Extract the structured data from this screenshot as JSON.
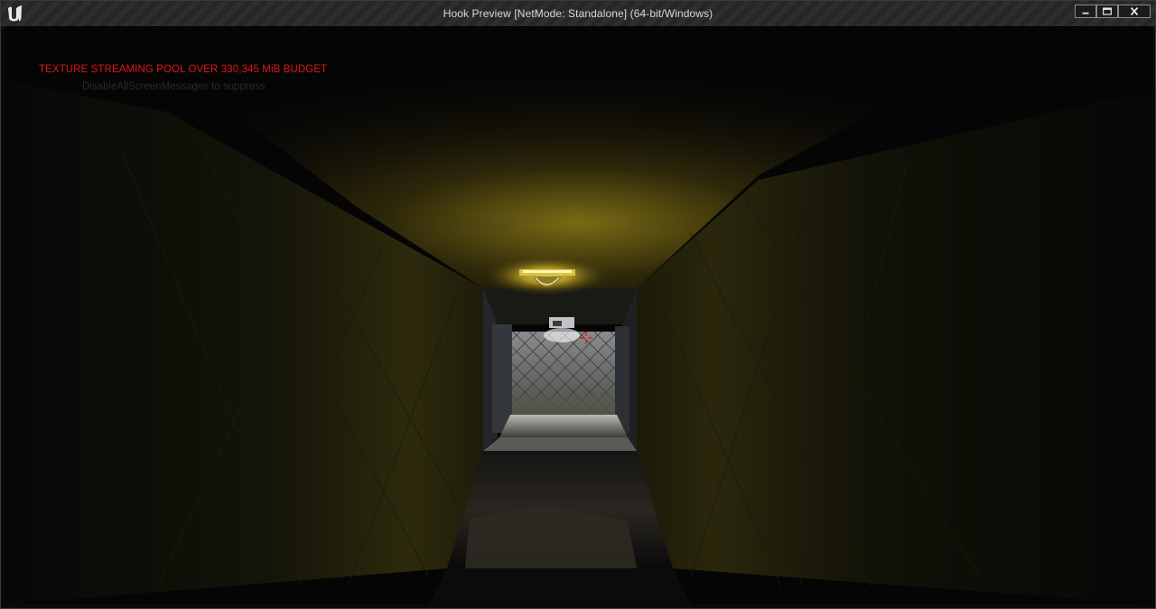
{
  "window": {
    "title": "Hook Preview [NetMode: Standalone]  (64-bit/Windows)",
    "icons": {
      "app": "unreal-engine-logo-icon",
      "minimize": "minimize-icon",
      "maximize": "maximize-icon",
      "close": "close-icon"
    }
  },
  "hud": {
    "warning": "TEXTURE STREAMING POOL OVER 330,345 MiB BUDGET",
    "subwarning": "DisableAllScreenMessages to suppress",
    "crosshair_icon": "crosshair-icon",
    "colors": {
      "warning": "#e0181a",
      "crosshair": "#e02020",
      "light": "#d8c23a"
    }
  }
}
